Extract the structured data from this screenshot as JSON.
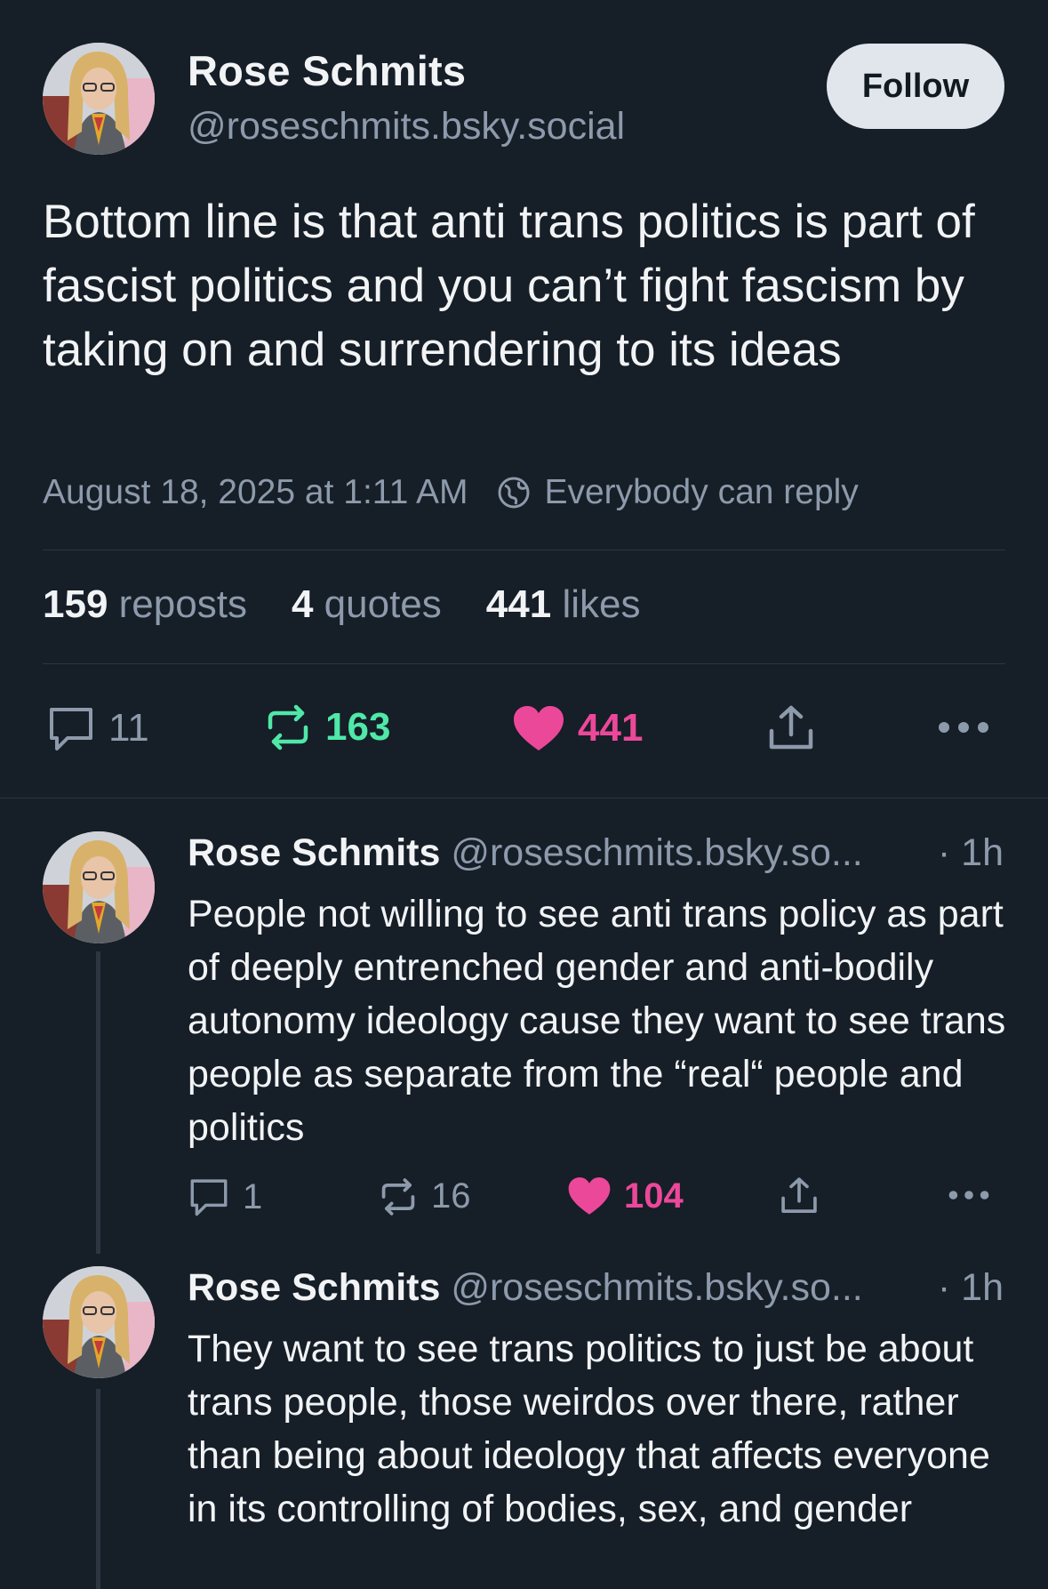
{
  "main_post": {
    "author_name": "Rose Schmits",
    "handle": "@roseschmits.bsky.social",
    "follow_label": "Follow",
    "text": "Bottom line is that anti trans politics is part of fascist politics and you can’t fight fascism by taking on and surrendering to its ideas",
    "timestamp": "August 18, 2025 at 1:11 AM",
    "reply_setting": "Everybody can reply",
    "stats": {
      "reposts_count": "159",
      "reposts_label": "reposts",
      "quotes_count": "4",
      "quotes_label": "quotes",
      "likes_count": "441",
      "likes_label": "likes"
    },
    "actions": {
      "replies": "11",
      "reposts": "163",
      "likes": "441"
    }
  },
  "replies": [
    {
      "author_name": "Rose Schmits",
      "handle": "@roseschmits.bsky.so...",
      "time": "· 1h",
      "text": "People not willing to see anti trans policy as part of deeply entrenched gender and anti-bodily autonomy ideology cause they want to see trans people as separate from the “real“ people and politics",
      "actions": {
        "replies": "1",
        "reposts": "16",
        "likes": "104"
      }
    },
    {
      "author_name": "Rose Schmits",
      "handle": "@roseschmits.bsky.so...",
      "time": "· 1h",
      "text": "They want to see trans politics to just be about trans people, those weirdos over there, rather than being about ideology that affects everyone in its controlling of bodies, sex, and gender"
    }
  ],
  "colors": {
    "background": "#161e27",
    "muted_text": "#8d9aab",
    "repost_green": "#4fe8a8",
    "like_pink": "#ec4899",
    "divider": "#2b3642"
  },
  "icons": [
    "reply-icon",
    "repost-icon",
    "heart-icon",
    "share-icon",
    "more-icon",
    "globe-icon"
  ]
}
